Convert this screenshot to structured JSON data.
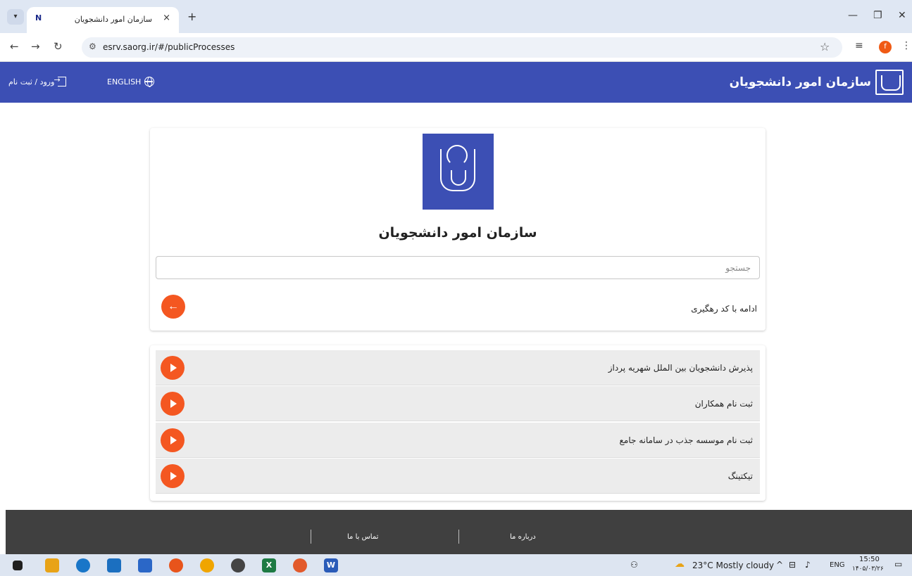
{
  "browser": {
    "tab_title": "سازمان امور دانشجویان",
    "tab_favicon": "N",
    "tab_close": "×",
    "new_tab": "+",
    "url": "esrv.saorg.ir/#/publicProcesses",
    "profile_initial": "f"
  },
  "header": {
    "brand_title": "سازمان امور دانشجویان",
    "language_label": "ENGLISH",
    "login_label": "ورود / ثبت نام"
  },
  "card": {
    "title": "سازمان امور دانشجویان",
    "search_placeholder": "جستجو",
    "tracking_label": "ادامه با کد رهگیری",
    "tracking_button": "←"
  },
  "processes": [
    {
      "label": "پذیرش دانشجویان بین الملل شهریه پرداز"
    },
    {
      "label": "ثبت نام همکاران"
    },
    {
      "label": "ثبت نام موسسه جذب در سامانه جامع"
    },
    {
      "label": "تیکتینگ"
    }
  ],
  "footer": {
    "about_label": "درباره ما",
    "contact_label": "تماس با ما"
  },
  "taskbar": {
    "weather": "23°C  Mostly cloudy",
    "lang": "ENG",
    "time": "15:50",
    "date": "۱۴۰۵/۰۳/۲۶"
  },
  "colors": {
    "brand_blue": "#3c4fb4",
    "accent_orange": "#f45721",
    "footer_gray": "#404040"
  }
}
